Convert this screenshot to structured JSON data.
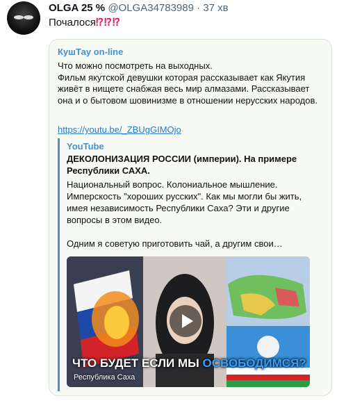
{
  "tweet": {
    "name": "OLGA 25 %",
    "handle": "@OLGA34783989",
    "sep": "·",
    "time": "37 хв",
    "text": "Почалося",
    "marks": "⁉⁉⁉"
  },
  "telegram": {
    "channel": "КушТау on-line",
    "post_lines": [
      "Что можно посмотреть на выходных.",
      "Фильм якутской девушки которая рассказывает как Якутия живёт в нищете снабжая весь мир алмазами. Рассказывает она и о бытовом шовинизме в отношении нерусских народов."
    ],
    "link": "https://youtu.be/_ZBUgGIMOjo",
    "preview": {
      "source": "YouTube",
      "title": "ДЕКОЛОНИЗАЦИЯ РОССИИ (империи). На примере Республики САХА.",
      "description": "Национальный вопрос. Колониальное мышление. Имперскость \"хороших русских\". Как мы могли бы жить, имея независимость Республики Саха? Эти и другие вопросы в этом видео.",
      "description2": "Одним я советую приготовить чай, а другим свои…",
      "thumbnail": {
        "caption_before": "ЧТО БУДЕТ ЕСЛИ МЫ ",
        "caption_highlight": "ОСВОБОДИМСЯ?",
        "subcaption": "Республика Саха"
      }
    }
  },
  "colors": {
    "accent": "#4a90c8",
    "link": "#2a7bc2",
    "marks": "#e0245e"
  }
}
